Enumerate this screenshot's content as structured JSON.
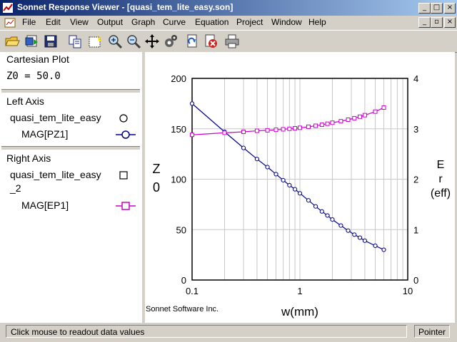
{
  "window": {
    "title": "Sonnet Response Viewer - [quasi_tem_lite_easy.son]"
  },
  "menu": [
    "File",
    "Edit",
    "View",
    "Output",
    "Graph",
    "Curve",
    "Equation",
    "Project",
    "Window",
    "Help"
  ],
  "toolbar": [
    "open-icon",
    "save-icon",
    "save-as-icon",
    "copy-icon",
    "select-icon",
    "zoom-in-icon",
    "zoom-out-icon",
    "pan-icon",
    "settings-icon",
    "refresh-icon",
    "stop-icon",
    "print-icon"
  ],
  "left_panel": {
    "plot_type": "Cartesian Plot",
    "z0": "Z0 = 50.0",
    "left_axis": {
      "heading": "Left Axis",
      "project": "quasi_tem_lite_easy",
      "measurement": "MAG[PZ1]"
    },
    "right_axis": {
      "heading": "Right Axis",
      "project": "quasi_tem_lite_easy",
      "project_suffix": "_2",
      "measurement": "MAG[EP1]"
    }
  },
  "plot": {
    "footer": "Sonnet Software Inc.",
    "xlabel": "w(mm)",
    "ylabel_left": [
      "Z",
      "0"
    ],
    "ylabel_right": [
      "E",
      "r",
      "(eff)"
    ],
    "left_ticks": [
      "200",
      "150",
      "100",
      "50",
      "0"
    ],
    "right_ticks": [
      "4",
      "3",
      "2",
      "1",
      "0"
    ],
    "x_ticks": [
      "0.1",
      "1",
      "10"
    ]
  },
  "chart_data": {
    "type": "line",
    "xscale": "log",
    "xlabel": "w(mm)",
    "xlim": [
      0.1,
      10
    ],
    "grid": true,
    "y_left": {
      "label": "Z0",
      "lim": [
        0,
        200
      ]
    },
    "y_right": {
      "label": "Er (eff)",
      "lim": [
        0,
        4
      ]
    },
    "series": [
      {
        "name": "MAG[PZ1]",
        "axis": "left",
        "marker": "circle",
        "color": "#00008b",
        "x": [
          0.1,
          0.2,
          0.3,
          0.4,
          0.5,
          0.6,
          0.7,
          0.8,
          0.9,
          1.0,
          1.2,
          1.4,
          1.6,
          1.8,
          2.0,
          2.4,
          2.8,
          3.2,
          3.6,
          4.0,
          5.0,
          6.0
        ],
        "y": [
          175,
          147,
          131,
          120,
          112,
          105,
          99,
          94,
          90,
          86,
          79,
          73,
          68,
          64,
          60,
          54,
          49,
          45,
          42,
          39,
          34,
          30
        ]
      },
      {
        "name": "MAG[EP1]",
        "axis": "right",
        "marker": "square",
        "color": "#cc00cc",
        "x": [
          0.1,
          0.2,
          0.3,
          0.4,
          0.5,
          0.6,
          0.7,
          0.8,
          0.9,
          1.0,
          1.2,
          1.4,
          1.6,
          1.8,
          2.0,
          2.4,
          2.8,
          3.2,
          3.6,
          4.0,
          5.0,
          6.0
        ],
        "y": [
          2.88,
          2.92,
          2.94,
          2.96,
          2.97,
          2.98,
          2.99,
          3.0,
          3.01,
          3.02,
          3.04,
          3.06,
          3.08,
          3.1,
          3.12,
          3.15,
          3.18,
          3.21,
          3.24,
          3.27,
          3.34,
          3.42
        ]
      }
    ]
  },
  "status": {
    "message": "Click mouse to readout data values",
    "mode": "Pointer"
  }
}
